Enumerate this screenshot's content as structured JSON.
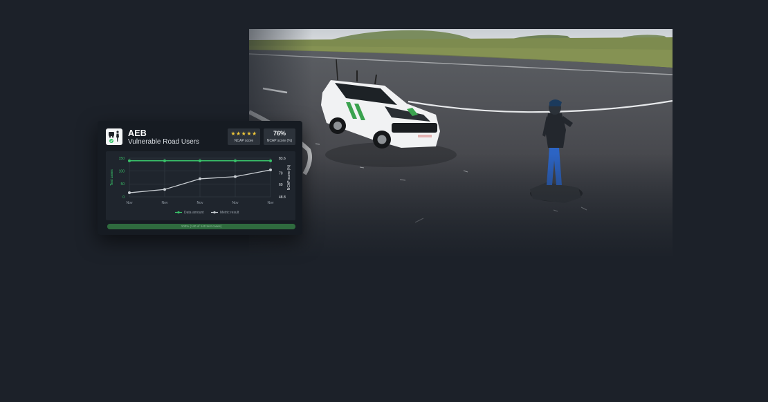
{
  "card": {
    "title": "AEB",
    "subtitle": "Vulnerable Road Users",
    "icon": "vru-pedestrian-icon",
    "stars": "★★★★★",
    "ncap_score_caption": "NCAP score",
    "ncap_percent": "76%",
    "ncap_percent_caption": "NCAP score (%)"
  },
  "chart_data": {
    "type": "line",
    "categories": [
      "Nov",
      "Nov",
      "Nov",
      "Nov",
      "Nov"
    ],
    "left_axis": {
      "label": "Test cases",
      "ticks": [
        "150",
        "100",
        "50",
        "0"
      ],
      "ylim": [
        0,
        150
      ]
    },
    "right_axis": {
      "label": "NCAP score (%)",
      "ticks": [
        "83.6",
        "70",
        "60",
        "48.8"
      ],
      "ylim": [
        48.8,
        83.6
      ]
    },
    "series": [
      {
        "name": "Data amount",
        "axis": "left",
        "color": "#39c46a",
        "values": [
          140,
          140,
          140,
          140,
          140
        ]
      },
      {
        "name": "Metric result",
        "axis": "right",
        "color": "#c8cdd2",
        "values": [
          52.5,
          55.5,
          65,
          67,
          73
        ]
      }
    ],
    "grid": true,
    "legend": "bottom"
  },
  "progress": {
    "text": "100% (140 of 140 test cases)",
    "fraction": 1.0
  },
  "colors": {
    "background": "#1c2129",
    "card": "#161b22",
    "accent_green": "#39c46a"
  }
}
